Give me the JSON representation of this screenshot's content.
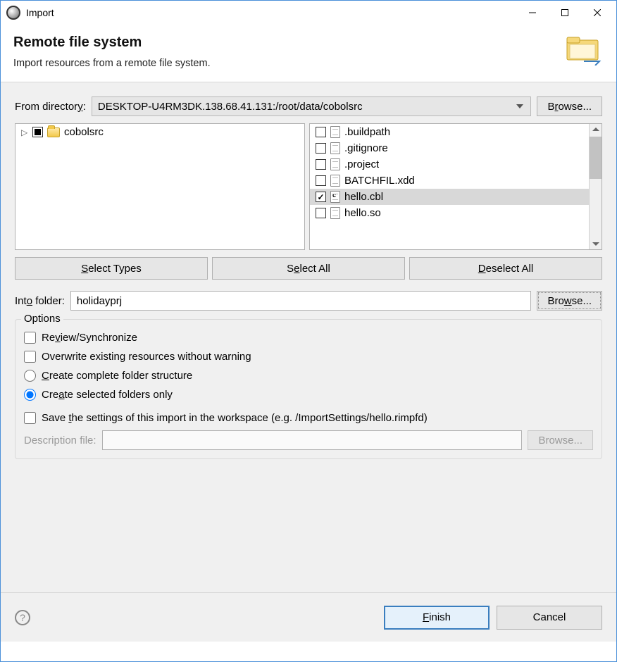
{
  "window": {
    "title": "Import"
  },
  "header": {
    "title": "Remote file system",
    "subtitle": "Import resources from a remote file system."
  },
  "fromDirectory": {
    "label_pre": "From director",
    "label_u": "y",
    "label_post": ":",
    "value": "DESKTOP-U4RM3DK.138.68.41.131:/root/data/cobolsrc",
    "browse_pre": "B",
    "browse_u": "r",
    "browse_post": "owse..."
  },
  "tree": {
    "items": [
      {
        "name": "cobolsrc",
        "checked": "intermediate"
      }
    ]
  },
  "files": [
    {
      "name": ".buildpath",
      "checked": false,
      "selected": false,
      "type": "file"
    },
    {
      "name": ".gitignore",
      "checked": false,
      "selected": false,
      "type": "file"
    },
    {
      "name": ".project",
      "checked": false,
      "selected": false,
      "type": "file"
    },
    {
      "name": "BATCHFIL.xdd",
      "checked": false,
      "selected": false,
      "type": "file"
    },
    {
      "name": "hello.cbl",
      "checked": true,
      "selected": true,
      "type": "cbl"
    },
    {
      "name": "hello.so",
      "checked": false,
      "selected": false,
      "type": "file"
    }
  ],
  "buttons": {
    "selectTypes_u": "S",
    "selectTypes_post": "elect Types",
    "selectAll_pre": "S",
    "selectAll_u": "e",
    "selectAll_post": "lect All",
    "deselect_u": "D",
    "deselect_post": "eselect All"
  },
  "intoFolder": {
    "label_pre": "Int",
    "label_u": "o",
    "label_post": " folder:",
    "value": "holidayprj",
    "browse_pre": "Bro",
    "browse_u": "w",
    "browse_post": "se..."
  },
  "options": {
    "legend": "Options",
    "review_pre": "Re",
    "review_u": "v",
    "review_post": "iew/Synchronize",
    "overwrite": "Overwrite existing resources without warning",
    "complete_u": "C",
    "complete_post": "reate complete folder structure",
    "selected_pre": "Cre",
    "selected_u": "a",
    "selected_post": "te selected folders only",
    "save_pre": "Save ",
    "save_u": "t",
    "save_post": "he settings of this import in the workspace (e.g. /ImportSettings/hello.rimpfd)"
  },
  "descriptionFile": {
    "label": "Description file:",
    "browse": "Browse..."
  },
  "footer": {
    "finish_u": "F",
    "finish_post": "inish",
    "cancel": "Cancel"
  }
}
